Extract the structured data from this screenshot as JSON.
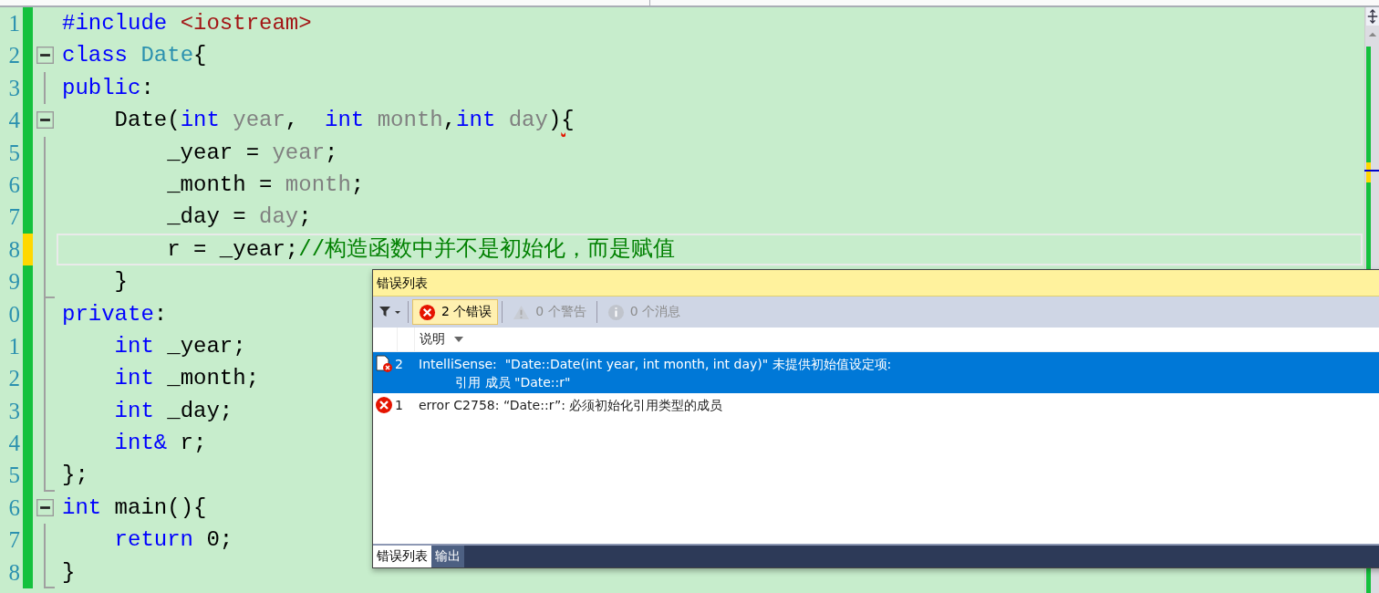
{
  "editor": {
    "lines": [
      {
        "number": "1",
        "unsaved": false,
        "kind": "plain",
        "current": false,
        "tokens": [
          {
            "text": "#include ",
            "kind": "keyword"
          },
          {
            "text": "<iostream>",
            "kind": "string"
          }
        ]
      },
      {
        "number": "2",
        "unsaved": false,
        "kind": "fold_start",
        "current": false,
        "tokens": [
          {
            "text": "class ",
            "kind": "keyword"
          },
          {
            "text": "Date",
            "kind": "type"
          },
          {
            "text": "{",
            "kind": "plain"
          }
        ]
      },
      {
        "number": "3",
        "unsaved": false,
        "kind": "fold_body",
        "current": false,
        "tokens": [
          {
            "text": "public",
            "kind": "keyword"
          },
          {
            "text": ":",
            "kind": "plain"
          }
        ]
      },
      {
        "number": "4",
        "unsaved": false,
        "kind": "fold_start",
        "current": false,
        "tokens": [
          {
            "text": "    Date(",
            "kind": "plain"
          },
          {
            "text": "int ",
            "kind": "keyword"
          },
          {
            "text": "year",
            "kind": "param"
          },
          {
            "text": ",  ",
            "kind": "plain"
          },
          {
            "text": "int ",
            "kind": "keyword"
          },
          {
            "text": "month",
            "kind": "param"
          },
          {
            "text": ",",
            "kind": "plain"
          },
          {
            "text": "int ",
            "kind": "keyword"
          },
          {
            "text": "day",
            "kind": "param"
          },
          {
            "text": ")",
            "kind": "plain"
          },
          {
            "text": "{",
            "kind": "plain",
            "squiggle": true
          }
        ]
      },
      {
        "number": "5",
        "unsaved": false,
        "kind": "fold_body",
        "current": false,
        "tokens": [
          {
            "text": "        _year = ",
            "kind": "plain"
          },
          {
            "text": "year",
            "kind": "param"
          },
          {
            "text": ";",
            "kind": "plain"
          }
        ]
      },
      {
        "number": "6",
        "unsaved": false,
        "kind": "fold_body",
        "current": false,
        "tokens": [
          {
            "text": "        _month = ",
            "kind": "plain"
          },
          {
            "text": "month",
            "kind": "param"
          },
          {
            "text": ";",
            "kind": "plain"
          }
        ]
      },
      {
        "number": "7",
        "unsaved": false,
        "kind": "fold_body",
        "current": false,
        "tokens": [
          {
            "text": "        _day = ",
            "kind": "plain"
          },
          {
            "text": "day",
            "kind": "param"
          },
          {
            "text": ";",
            "kind": "plain"
          }
        ]
      },
      {
        "number": "8",
        "unsaved": true,
        "kind": "fold_body",
        "current": true,
        "tokens": [
          {
            "text": "        r = _year;",
            "kind": "plain"
          },
          {
            "text": "//构造函数中并不是初始化，而是赋值",
            "kind": "comment"
          }
        ]
      },
      {
        "number": "9",
        "unsaved": false,
        "kind": "fold_end",
        "current": false,
        "tokens": [
          {
            "text": "    }",
            "kind": "plain"
          }
        ]
      },
      {
        "number": "0",
        "unsaved": false,
        "kind": "fold_body",
        "current": false,
        "tokens": [
          {
            "text": "private",
            "kind": "keyword"
          },
          {
            "text": ":",
            "kind": "plain"
          }
        ]
      },
      {
        "number": "1",
        "unsaved": false,
        "kind": "fold_body",
        "current": false,
        "tokens": [
          {
            "text": "    int",
            "kind": "keyword"
          },
          {
            "text": " _year;",
            "kind": "plain"
          }
        ]
      },
      {
        "number": "2",
        "unsaved": false,
        "kind": "fold_body",
        "current": false,
        "tokens": [
          {
            "text": "    int",
            "kind": "keyword"
          },
          {
            "text": " _month;",
            "kind": "plain"
          }
        ]
      },
      {
        "number": "3",
        "unsaved": false,
        "kind": "fold_body",
        "current": false,
        "tokens": [
          {
            "text": "    int",
            "kind": "keyword"
          },
          {
            "text": " _day;",
            "kind": "plain"
          }
        ]
      },
      {
        "number": "4",
        "unsaved": false,
        "kind": "fold_body",
        "current": false,
        "tokens": [
          {
            "text": "    int&",
            "kind": "keyword"
          },
          {
            "text": " r;",
            "kind": "plain"
          }
        ]
      },
      {
        "number": "5",
        "unsaved": false,
        "kind": "fold_end",
        "current": false,
        "tokens": [
          {
            "text": "};",
            "kind": "plain"
          }
        ]
      },
      {
        "number": "6",
        "unsaved": false,
        "kind": "fold_start",
        "current": false,
        "tokens": [
          {
            "text": "int",
            "kind": "keyword"
          },
          {
            "text": " main(){",
            "kind": "plain"
          }
        ]
      },
      {
        "number": "7",
        "unsaved": false,
        "kind": "fold_body",
        "current": false,
        "tokens": [
          {
            "text": "    return",
            "kind": "keyword"
          },
          {
            "text": " 0;",
            "kind": "plain"
          }
        ]
      },
      {
        "number": "8",
        "unsaved": false,
        "kind": "fold_end",
        "current": false,
        "tokens": [
          {
            "text": "}",
            "kind": "plain"
          }
        ]
      }
    ]
  },
  "error_list": {
    "title": "错误列表",
    "filters": [
      {
        "label": "2 个错误",
        "kind": "error",
        "selected": true,
        "disabled": false
      },
      {
        "label": "0 个警告",
        "kind": "warning",
        "selected": false,
        "disabled": true
      },
      {
        "label": "0 个消息",
        "kind": "message",
        "selected": false,
        "disabled": true
      }
    ],
    "column": "说明",
    "rows": [
      {
        "kind": "intellisense",
        "number": "2",
        "selected": true,
        "lines": [
          "IntelliSense:  \"Date::Date(int year, int month, int day)\" 未提供初始值设定项:",
          "         引用 成员 \"Date::r\""
        ]
      },
      {
        "kind": "error",
        "number": "1",
        "selected": false,
        "lines": [
          "error C2758: “Date::r”: 必须初始化引用类型的成员"
        ]
      }
    ],
    "tabs": [
      {
        "label": "错误列表",
        "selected": true
      },
      {
        "label": "输出",
        "selected": false
      }
    ]
  }
}
